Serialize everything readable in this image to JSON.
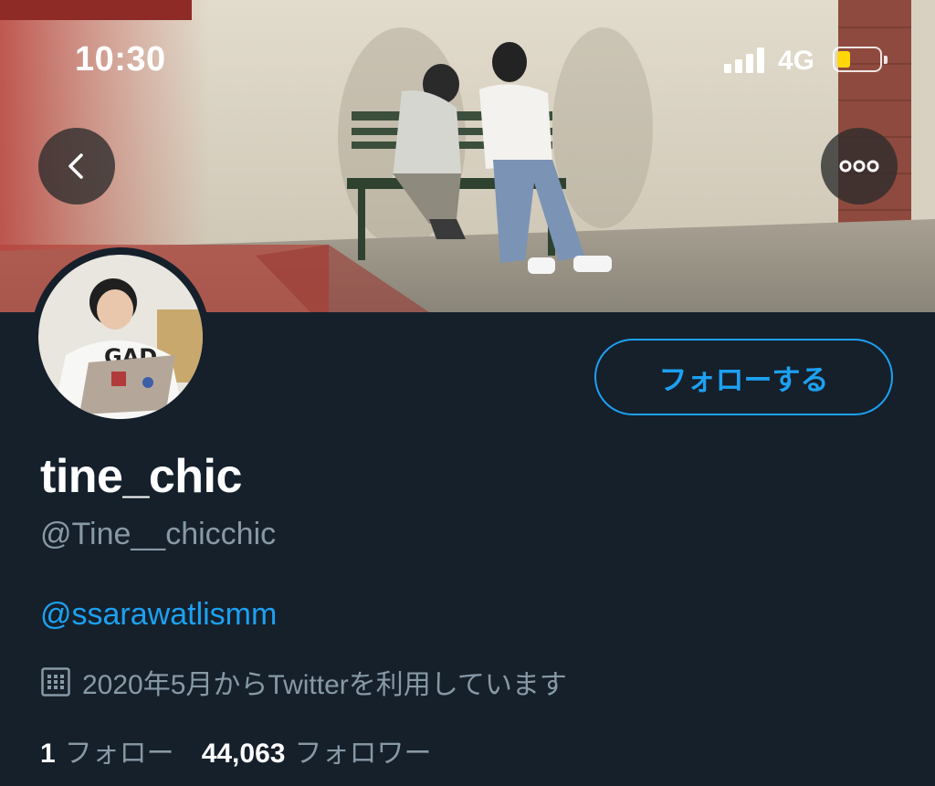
{
  "status_bar": {
    "time": "10:30",
    "network": "4G",
    "battery_level": 0.2,
    "battery_color": "#ffd60a"
  },
  "header": {
    "back_icon": "chevron-left-icon",
    "more_icon": "more-horizontal-icon"
  },
  "profile": {
    "display_name": "tine_chic",
    "handle": "@Tine__chicchic",
    "bio_link": "@ssarawatlismm",
    "joined_icon": "calendar-icon",
    "joined_text": "2020年5月からTwitterを利用しています",
    "follow_button_label": "フォローする",
    "following_count": "1",
    "following_label": "フォロー",
    "followers_count": "44,063",
    "followers_label": "フォロワー"
  },
  "colors": {
    "background": "#15202b",
    "accent": "#1da1f2",
    "secondary_text": "#8899a6",
    "primary_text": "#ffffff"
  }
}
